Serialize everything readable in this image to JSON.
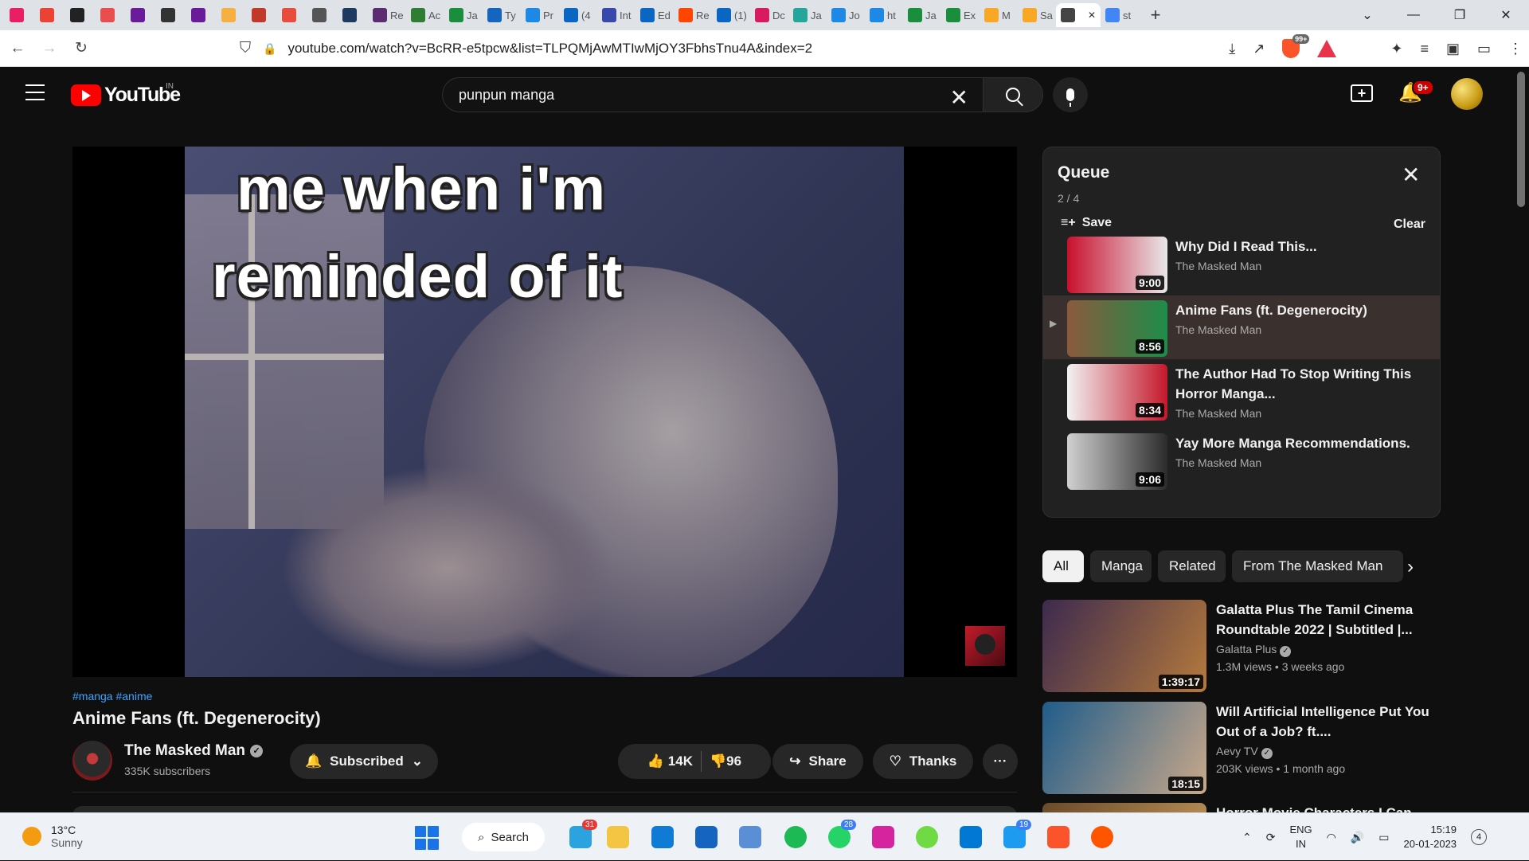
{
  "browser": {
    "tabs": [
      {
        "label": "",
        "icon": "download-icon",
        "color": "#e91e63"
      },
      {
        "label": "",
        "icon": "gmail-icon",
        "color": "#ea4335"
      },
      {
        "label": "",
        "icon": "4k-icon",
        "color": "#222222"
      },
      {
        "label": "",
        "icon": "app-icon",
        "color": "#e94e4e"
      },
      {
        "label": "",
        "icon": "play-icon",
        "color": "#6a1b9a"
      },
      {
        "label": "",
        "icon": "game-icon",
        "color": "#333333"
      },
      {
        "label": "",
        "icon": "play-icon",
        "color": "#6a1b9a"
      },
      {
        "label": "",
        "icon": "cat-icon",
        "color": "#f5b041"
      },
      {
        "label": "",
        "icon": "record-icon",
        "color": "#c0392b"
      },
      {
        "label": "",
        "icon": "stop-icon",
        "color": "#e74c3c"
      },
      {
        "label": "",
        "icon": "globe-icon",
        "color": "#555555"
      },
      {
        "label": "",
        "icon": "s-icon",
        "color": "#1e3a5f"
      },
      {
        "label": "Re",
        "icon": "m-icon",
        "color": "#5b2c6f"
      },
      {
        "label": "Ac",
        "icon": "leaf-icon",
        "color": "#2e7d32"
      },
      {
        "label": "Ja",
        "icon": "w-icon",
        "color": "#1b8e3d"
      },
      {
        "label": "Ty",
        "icon": "printer-icon",
        "color": "#1565c0"
      },
      {
        "label": "Pr",
        "icon": "c-icon",
        "color": "#1e88e5"
      },
      {
        "label": "(4",
        "icon": "linkedin-icon",
        "color": "#0a66c2"
      },
      {
        "label": "Int",
        "icon": "flag-icon",
        "color": "#3949ab"
      },
      {
        "label": "Ed",
        "icon": "linkedin-icon",
        "color": "#0a66c2"
      },
      {
        "label": "Re",
        "icon": "reddit-icon",
        "color": "#ff4500"
      },
      {
        "label": "(1)",
        "icon": "linkedin-icon",
        "color": "#0a66c2"
      },
      {
        "label": "Dc",
        "icon": "heart-icon",
        "color": "#d81b60"
      },
      {
        "label": "Ja",
        "icon": "chart-icon",
        "color": "#26a69a"
      },
      {
        "label": "Jo",
        "icon": "c-icon",
        "color": "#1e88e5"
      },
      {
        "label": "ht",
        "icon": "c-icon",
        "color": "#1e88e5"
      },
      {
        "label": "Ja",
        "icon": "w-icon",
        "color": "#1b8e3d"
      },
      {
        "label": "Ex",
        "icon": "w-icon",
        "color": "#1b8e3d"
      },
      {
        "label": "M",
        "icon": "bolt-icon",
        "color": "#f9a825"
      },
      {
        "label": "Sa",
        "icon": "bolt-icon",
        "color": "#f9a825"
      },
      {
        "label": "",
        "icon": "speaker-icon",
        "color": "#444444"
      },
      {
        "label": "st",
        "icon": "google-icon",
        "color": "#4285f4"
      }
    ],
    "url": "youtube.com/watch?v=BcRR-e5tpcw&list=TLPQMjAwMTIwMjOY3FbhsTnu4A&index=2",
    "shield_badge": "99+"
  },
  "yt": {
    "logo_text": "YouTube",
    "country": "IN",
    "search_value": "punpun manga",
    "notif_count": "9+"
  },
  "player": {
    "meme_line1": "me when i'm",
    "meme_line2": "reminded of it"
  },
  "video": {
    "tags": "#manga #anime",
    "title": "Anime Fans (ft. Degenerocity)",
    "channel": "The Masked Man",
    "subscribers": "335K subscribers",
    "subscribed_label": "Subscribed",
    "likes": "14K",
    "dislikes": "96",
    "share_label": "Share",
    "thanks_label": "Thanks"
  },
  "queue": {
    "title": "Queue",
    "position": "2 / 4",
    "save_label": "Save",
    "clear_label": "Clear",
    "items": [
      {
        "title": "Why Did I Read This...",
        "channel": "The Masked Man",
        "duration": "9:00",
        "colors": [
          "#c8102e",
          "#e8e8e8"
        ]
      },
      {
        "title": "Anime Fans (ft. Degenerocity)",
        "channel": "The Masked Man",
        "duration": "8:56",
        "colors": [
          "#8a5a3c",
          "#1e8c4a"
        ]
      },
      {
        "title": "The Author Had To Stop Writing This Horror Manga...",
        "channel": "The Masked Man",
        "duration": "8:34",
        "colors": [
          "#f2f2f2",
          "#c4182b"
        ]
      },
      {
        "title": "Yay More Manga Recommendations.",
        "channel": "The Masked Man",
        "duration": "9:06",
        "colors": [
          "#d0d0d0",
          "#2b2b2b"
        ]
      }
    ]
  },
  "chips": [
    "All",
    "Manga",
    "Related",
    "From The Masked Man"
  ],
  "recommendations": [
    {
      "title": "Galatta Plus The Tamil Cinema Roundtable 2022 | Subtitled |...",
      "channel": "Galatta Plus",
      "views": "1.3M views",
      "age": "3 weeks ago",
      "duration": "1:39:17",
      "colors": [
        "#3d2a4e",
        "#b57a3c"
      ]
    },
    {
      "title": "Will Artificial Intelligence Put You Out of a Job? ft....",
      "channel": "Aevy TV",
      "views": "203K views",
      "age": "1 month ago",
      "duration": "18:15",
      "colors": [
        "#1f5c8a",
        "#c9a88a"
      ]
    },
    {
      "title": "Horror Movie Characters I Can...",
      "channel": "",
      "views": "",
      "age": "",
      "duration": "",
      "colors": [
        "#6b4a2a",
        "#c59b5e"
      ]
    }
  ],
  "taskbar": {
    "temp": "13°C",
    "condition": "Sunny",
    "search_label": "Search",
    "lang1": "ENG",
    "lang2": "IN",
    "time": "15:19",
    "date": "20-01-2023",
    "notifications": "4",
    "apps": [
      {
        "name": "telegram-icon",
        "color": "#2aa3df",
        "badge": "31"
      },
      {
        "name": "file-explorer-icon",
        "color": "#f4c542",
        "badge": ""
      },
      {
        "name": "edge-icon",
        "color": "#0f7bd4",
        "badge": ""
      },
      {
        "name": "mail-icon",
        "color": "#1565c0",
        "badge": ""
      },
      {
        "name": "notepad-icon",
        "color": "#5a8fd6",
        "badge": ""
      },
      {
        "name": "spotify-icon",
        "color": "#1db954",
        "badge": ""
      },
      {
        "name": "whatsapp-icon",
        "color": "#25d366",
        "badge": "28"
      },
      {
        "name": "instagram-icon",
        "color": "#d6249f",
        "badge": ""
      },
      {
        "name": "upwork-icon",
        "color": "#6fda44",
        "badge": ""
      },
      {
        "name": "vscode-icon",
        "color": "#0078d4",
        "badge": ""
      },
      {
        "name": "twitter-icon",
        "color": "#1d9bf0",
        "badge": "19"
      },
      {
        "name": "brave-icon",
        "color": "#fb542b",
        "badge": ""
      },
      {
        "name": "soundcloud-icon",
        "color": "#ff5500",
        "badge": ""
      }
    ]
  }
}
